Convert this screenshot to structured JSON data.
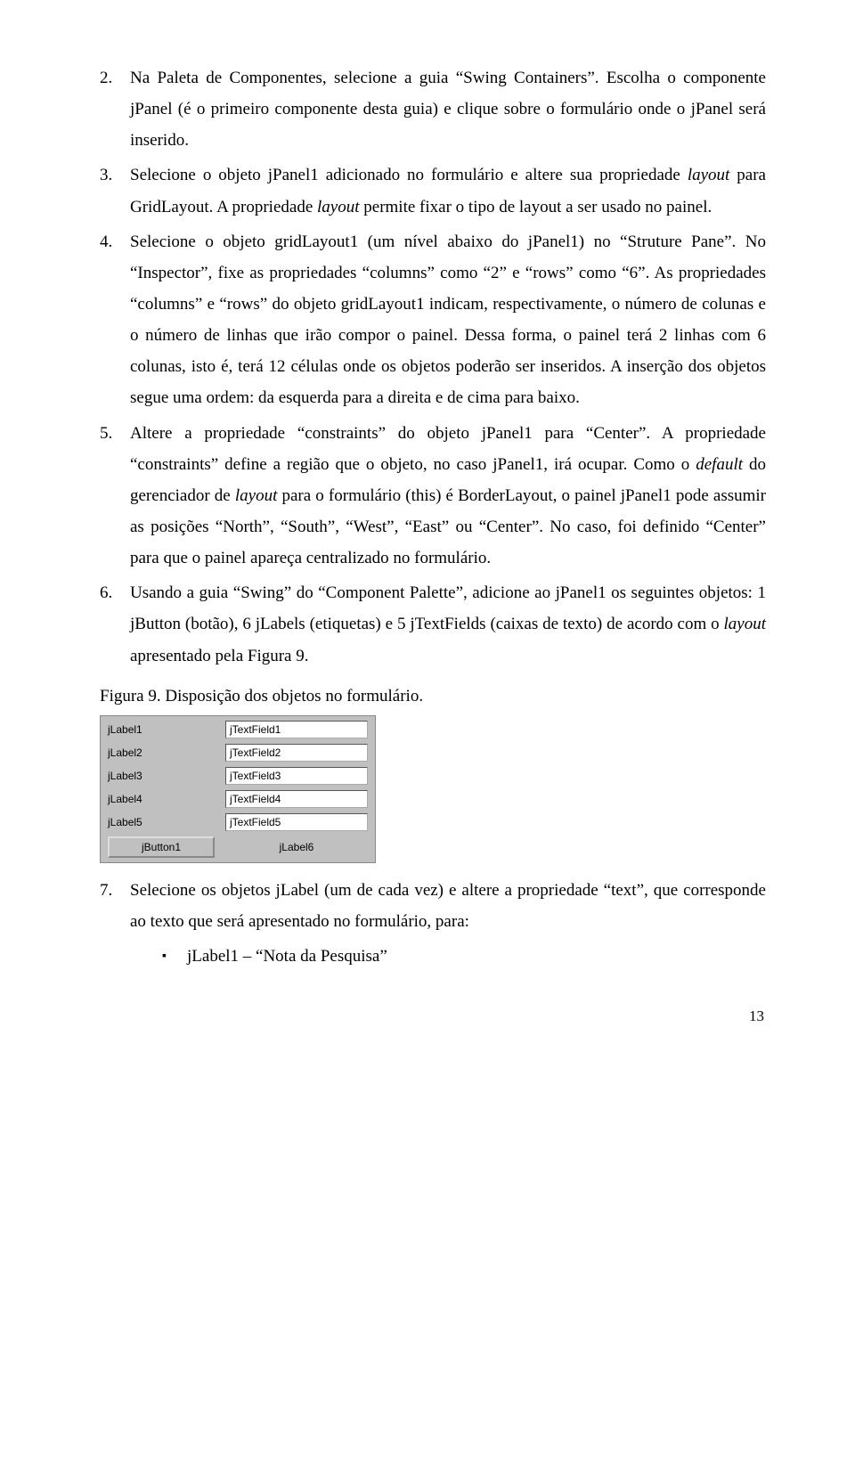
{
  "items": [
    {
      "num": "2.",
      "text": "Na Paleta de Componentes, selecione a guia “Swing Containers”. Escolha o componente jPanel (é o primeiro componente desta guia) e clique sobre o formulário onde o jPanel será inserido."
    },
    {
      "num": "3.",
      "pre": "Selecione o objeto jPanel1 adicionado no formulário e altere sua propriedade ",
      "i1": "layout",
      "mid": " para GridLayout. A propriedade ",
      "i2": "layout",
      "post": " permite fixar o tipo de layout a ser usado no painel."
    },
    {
      "num": "4.",
      "text": "Selecione o objeto gridLayout1 (um nível abaixo do jPanel1) no “Struture Pane”. No “Inspector”, fixe as propriedades “columns” como “2” e “rows” como “6”. As propriedades “columns” e “rows” do objeto gridLayout1 indicam, respectivamente, o número de colunas e o número de linhas que irão compor o painel. Dessa forma, o painel terá 2 linhas com 6 colunas, isto é, terá 12 células onde os objetos poderão ser inseridos. A inserção dos objetos segue uma ordem: da esquerda para a direita e de cima para baixo."
    },
    {
      "num": "5.",
      "pre": "Altere a propriedade “constraints” do objeto jPanel1 para “Center”. A propriedade “constraints” define a região que o objeto, no caso jPanel1, irá ocupar. Como o ",
      "i1": "default",
      "mid": " do gerenciador de ",
      "i2": "layout",
      "post": " para o formulário (this) é BorderLayout, o painel jPanel1 pode assumir as posições “North”, “South”, “West”, “East” ou “Center”. No caso, foi definido “Center” para que o painel apareça centralizado no formulário."
    },
    {
      "num": "6.",
      "pre": " Usando a guia “Swing” do “Component Palette”, adicione ao jPanel1 os seguintes objetos: 1 jButton (botão), 6 jLabels (etiquetas) e 5 jTextFields (caixas de texto) de acordo com o ",
      "i1": "layout",
      "post": " apresentado pela Figura 9."
    },
    {
      "num": "7.",
      "text": "Selecione os objetos jLabel (um de cada vez) e altere a propriedade “text”, que corresponde ao texto que será apresentado no formulário, para:"
    }
  ],
  "figure_caption": "Figura 9. Disposição dos objetos no formulário.",
  "form": {
    "rows": [
      {
        "label": "jLabel1",
        "field": "jTextField1"
      },
      {
        "label": "jLabel2",
        "field": "jTextField2"
      },
      {
        "label": "jLabel3",
        "field": "jTextField3"
      },
      {
        "label": "jLabel4",
        "field": "jTextField4"
      },
      {
        "label": "jLabel5",
        "field": "jTextField5"
      }
    ],
    "button": "jButton1",
    "last_label": "jLabel6"
  },
  "bullet": "jLabel1 – “Nota da Pesquisa”",
  "page_num": "13"
}
